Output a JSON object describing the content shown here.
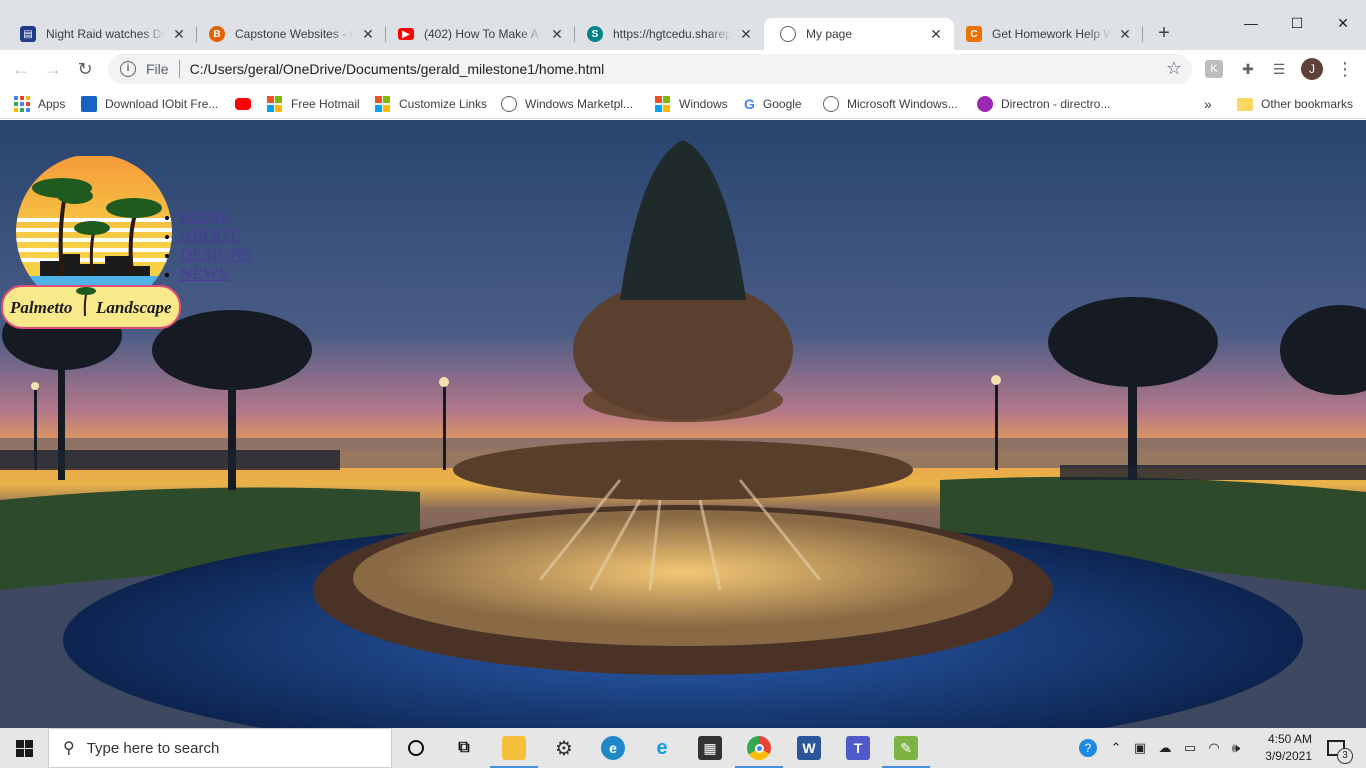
{
  "browser": {
    "tabs": [
      {
        "title": "Night Raid watches Dea",
        "icon": "notes-icon",
        "color": "#1f3b8a"
      },
      {
        "title": "Capstone Websites - CF",
        "icon": "canvas-icon",
        "color": "#e66000"
      },
      {
        "title": "(402) How To Make A W",
        "icon": "youtube-icon",
        "color": "#ff0000"
      },
      {
        "title": "https://hgtcedu.sharepo",
        "icon": "sharepoint-icon",
        "color": "#038387"
      },
      {
        "title": "My page",
        "icon": "globe-icon",
        "color": "#5f6368",
        "active": true
      },
      {
        "title": "Get Homework Help Wi",
        "icon": "chegg-icon",
        "color": "#eb7100"
      }
    ],
    "window_controls": {
      "minimize": "—",
      "maximize": "☐",
      "close": "✕"
    },
    "address": {
      "scheme_label": "File",
      "url": "C:/Users/geral/OneDrive/Documents/gerald_milestone1/home.html"
    },
    "profile_initial": "J",
    "bookmarks": [
      {
        "label": "Apps",
        "icon": "apps-grid-icon"
      },
      {
        "label": "Download IObit Fre...",
        "icon": "iobit-icon"
      },
      {
        "label": "",
        "icon": "youtube-icon"
      },
      {
        "label": "Free Hotmail",
        "icon": "microsoft-icon"
      },
      {
        "label": "Customize Links",
        "icon": "microsoft-icon"
      },
      {
        "label": "Windows Marketpl...",
        "icon": "globe-icon"
      },
      {
        "label": "Windows",
        "icon": "microsoft-icon"
      },
      {
        "label": "Google",
        "icon": "google-icon"
      },
      {
        "label": "Microsoft Windows...",
        "icon": "globe-icon"
      },
      {
        "label": "Directron - directro...",
        "icon": "directron-icon"
      }
    ],
    "more_bookmarks": "»",
    "other_bookmarks": "Other bookmarks"
  },
  "page": {
    "logo": {
      "line1": "Palmetto",
      "line2": "Landscape"
    },
    "nav": [
      "HOME",
      "ABOUT",
      "DESIGNS",
      "NEWS"
    ]
  },
  "taskbar": {
    "search_placeholder": "Type here to search",
    "time": "4:50 AM",
    "date": "3/9/2021",
    "notification_count": "3"
  }
}
